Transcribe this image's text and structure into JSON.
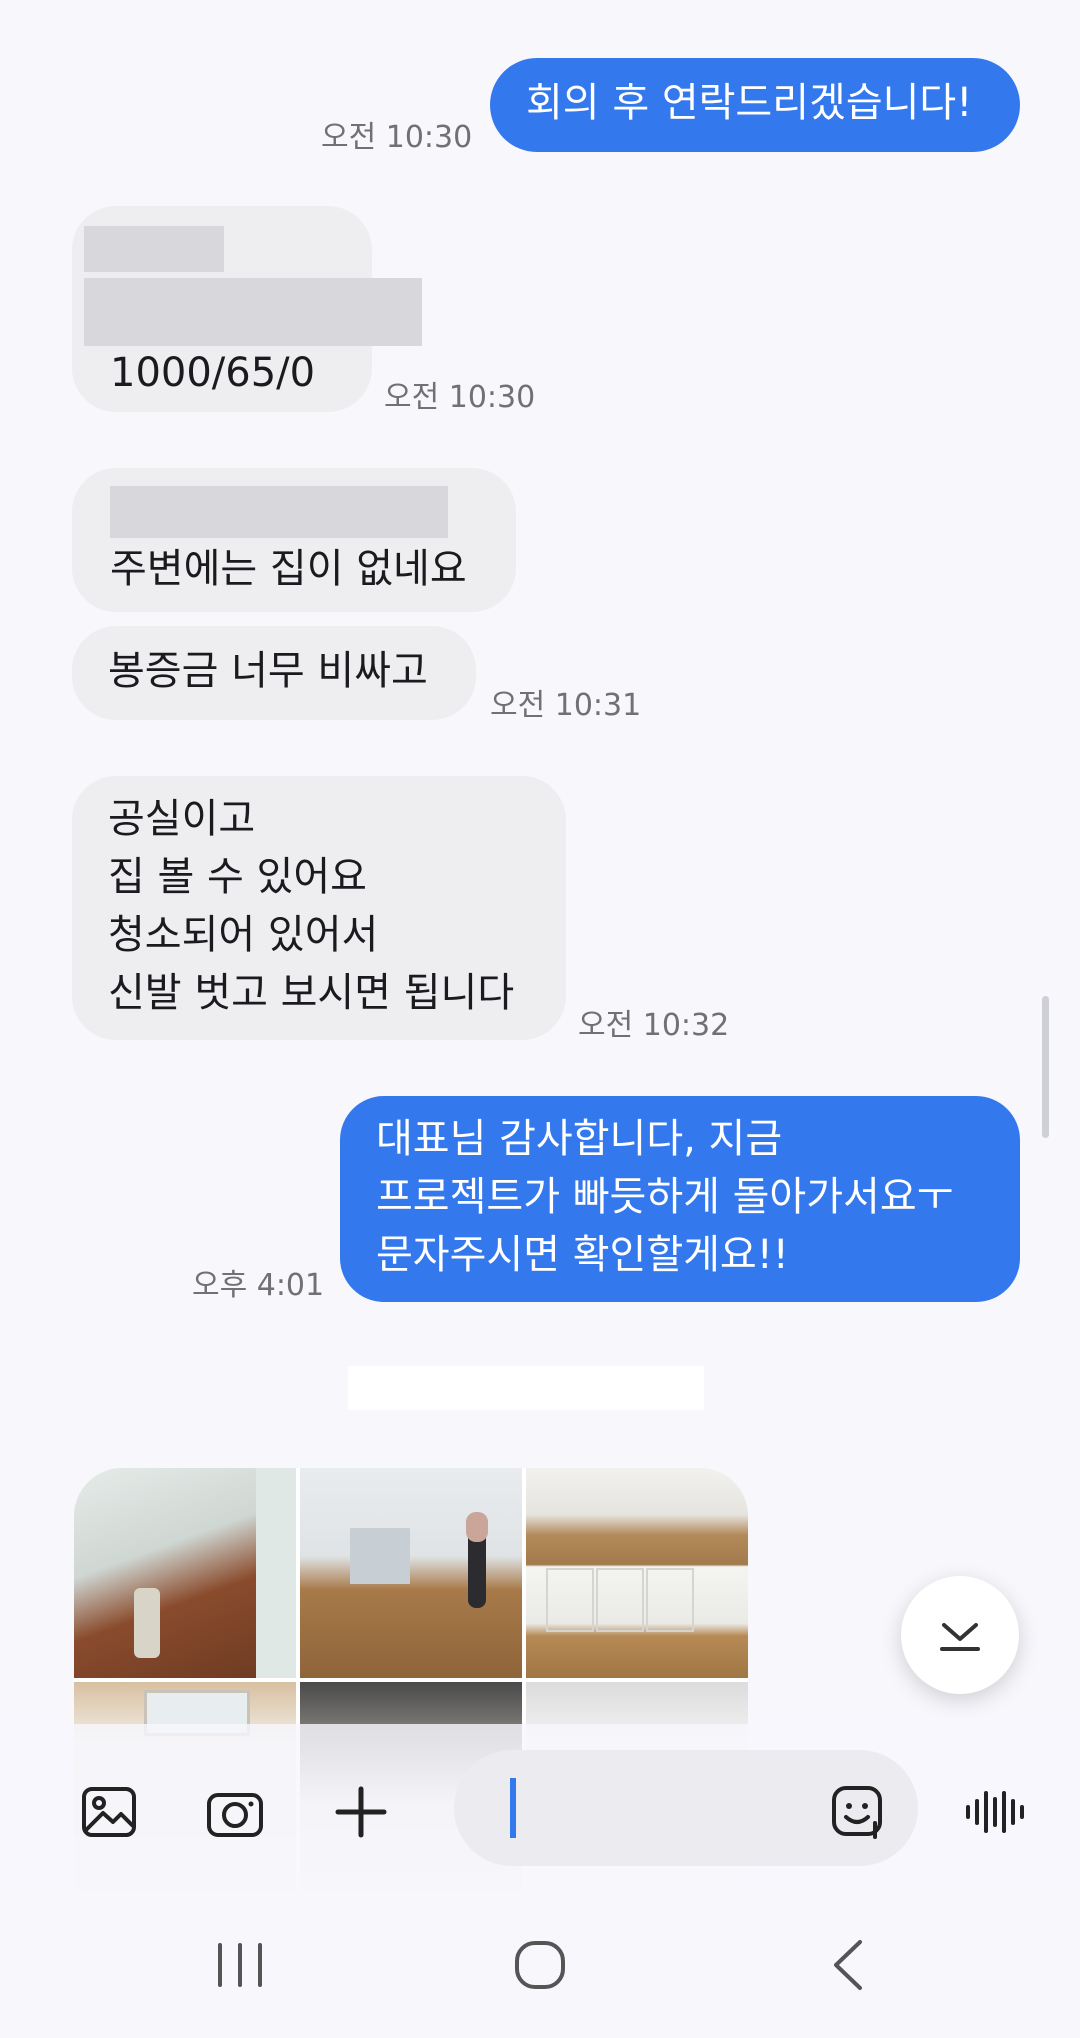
{
  "messages": {
    "m1": {
      "text": "회의 후 연락드리겠습니다!",
      "time": "오전 10:30"
    },
    "m2": {
      "text": "1000/65/0",
      "time": "오전 10:30"
    },
    "m3": {
      "text": "주변에는 집이 없네요"
    },
    "m4": {
      "text": "봉증금 너무 비싸고",
      "time": "오전 10:31"
    },
    "m5": {
      "lines": [
        "공실이고",
        "집 볼 수 있어요",
        "청소되어 있어서",
        "신발 벗고 보시면 됩니다"
      ],
      "time": "오전 10:32"
    },
    "m6": {
      "lines": [
        "대표님 감사합니다, 지금",
        "프로젝트가 빠듯하게 돌아가서요ㅜ",
        "문자주시면 확인할게요!!"
      ],
      "time": "오후 4:01"
    }
  },
  "photos": {
    "count_visible": 6,
    "items": [
      "closet-floor",
      "empty-room-person",
      "kitchen-counter",
      "window-room",
      "dark-room",
      "white-room"
    ]
  },
  "composer": {
    "icons": [
      "gallery-icon",
      "camera-icon",
      "plus-icon",
      "emoji-icon",
      "voice-icon"
    ],
    "input_value": ""
  },
  "nav": {
    "icons": [
      "recent-apps-icon",
      "home-icon",
      "back-icon"
    ]
  },
  "colors": {
    "sent_bubble": "#3478ee",
    "recv_bubble": "#eeeef1",
    "background": "#f7f7fc"
  }
}
